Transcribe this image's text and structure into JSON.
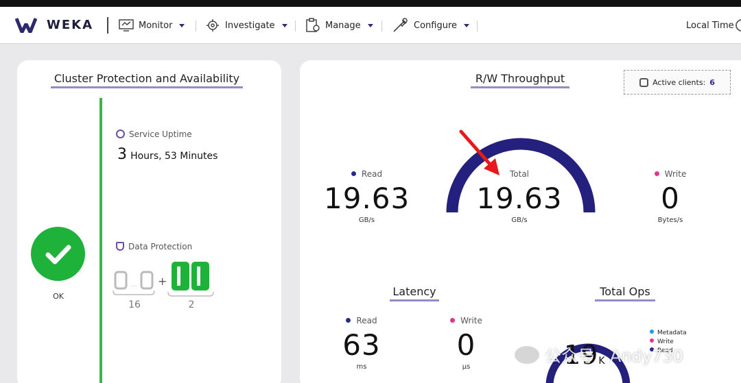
{
  "nav": {
    "brand": "WEKA",
    "items": [
      {
        "label": "Monitor",
        "icon": "monitor-icon"
      },
      {
        "label": "Investigate",
        "icon": "investigate-icon"
      },
      {
        "label": "Manage",
        "icon": "manage-icon"
      },
      {
        "label": "Configure",
        "icon": "configure-icon"
      }
    ],
    "local_time_label": "Local Time"
  },
  "cluster": {
    "title": "Cluster Protection and Availability",
    "status_label": "OK",
    "uptime_label": "Service Uptime",
    "uptime_hours": "3",
    "uptime_rest": "Hours, 53 Minutes",
    "protection_label": "Data Protection",
    "data_drives": "16",
    "protection_drives": "2",
    "plus": "+",
    "data_placeholder": "0...0",
    "protection_placeholder": "00"
  },
  "throughput": {
    "title": "R/W Throughput",
    "active_clients_label": "Active clients:",
    "active_clients_value": "6",
    "read_label": "Read",
    "read_value": "19.63",
    "read_unit": "GB/s",
    "total_label": "Total",
    "total_value": "19.63",
    "total_unit": "GB/s",
    "write_label": "Write",
    "write_value": "0",
    "write_unit": "Bytes/s"
  },
  "latency": {
    "title": "Latency",
    "read_label": "Read",
    "read_value": "63",
    "read_unit": "ms",
    "write_label": "Write",
    "write_value": "0",
    "write_unit": "µs"
  },
  "ops": {
    "title": "Total Ops",
    "value": "19",
    "suffix": "K",
    "legend": [
      "Metadata",
      "Write",
      "Read"
    ]
  },
  "colors": {
    "read_dot": "#2b2a8c",
    "write_dot": "#e0378a",
    "metadata_dot": "#1e9be0",
    "gauge": "#23207e",
    "ok_green": "#1fb23b",
    "arrow_red": "#e8191b"
  },
  "watermark": "公众号 · Andy730"
}
